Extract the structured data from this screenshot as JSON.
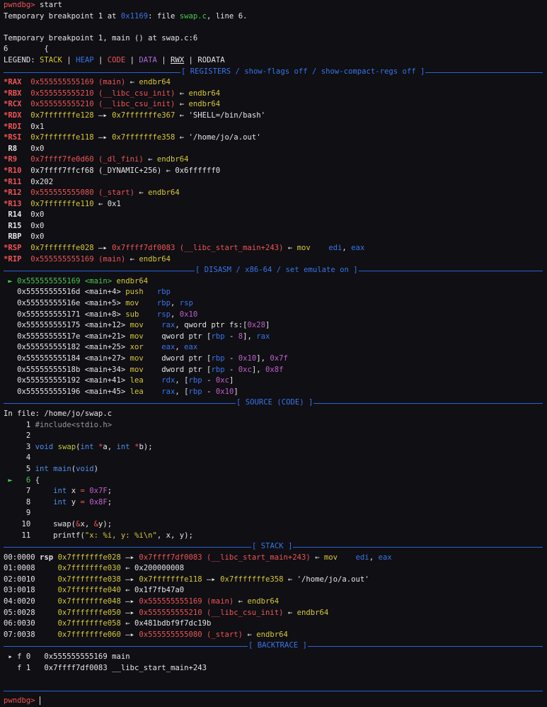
{
  "colors": {
    "bg": "#0f0f14",
    "red": "#ef5454",
    "blue": "#3a74e8",
    "green": "#4ac94a",
    "purple": "#b06bd6",
    "yellow": "#d8c73a"
  },
  "header": {
    "prompt": "pwndbg>",
    "command": " start",
    "bp_line_a": "Temporary breakpoint 1 at ",
    "bp_addr": "0x1169",
    "bp_line_b": ": file ",
    "bp_file": "swap.c",
    "bp_line_c": ", line 6.",
    "bp2": "Temporary breakpoint 1, main () at swap.c:6",
    "src_line": "6        {",
    "legend_label": "LEGEND: ",
    "legend_stack": "STACK",
    "legend_heap": "HEAP",
    "legend_code": "CODE",
    "legend_data": "DATA",
    "legend_rwx": "RWX",
    "legend_rodata": "RODATA",
    "pipe": " | "
  },
  "sections": {
    "registers": "[ REGISTERS / show-flags off / show-compact-regs off ]",
    "disasm": "[ DISASM / x86-64 / set emulate on ]",
    "source": "[ SOURCE (CODE) ]",
    "stack": "[ STACK ]",
    "backtrace": "[ BACKTRACE ]"
  },
  "registers": [
    {
      "mark": "*",
      "name": "RAX",
      "v1": "0x555555555169",
      "v1c": "red",
      "sym": " (main)",
      "symc": "red",
      "arrow": " ← ",
      "v2": "endbr64",
      "v2c": "yellow",
      "arrow2": "",
      "v3": "",
      "v3c": ""
    },
    {
      "mark": "*",
      "name": "RBX",
      "v1": "0x555555555210",
      "v1c": "red",
      "sym": " (__libc_csu_init)",
      "symc": "red",
      "arrow": " ← ",
      "v2": "endbr64",
      "v2c": "yellow",
      "arrow2": "",
      "v3": "",
      "v3c": ""
    },
    {
      "mark": "*",
      "name": "RCX",
      "v1": "0x555555555210",
      "v1c": "red",
      "sym": " (__libc_csu_init)",
      "symc": "red",
      "arrow": " ← ",
      "v2": "endbr64",
      "v2c": "yellow",
      "arrow2": "",
      "v3": "",
      "v3c": ""
    },
    {
      "mark": "*",
      "name": "RDX",
      "v1": "0x7fffffffe128",
      "v1c": "yellow",
      "sym": "",
      "symc": "",
      "arrow": " —▸ ",
      "v2": "0x7fffffffe367",
      "v2c": "yellow",
      "arrow2": " ← ",
      "v3": "'SHELL=/bin/bash'",
      "v3c": "white"
    },
    {
      "mark": "*",
      "name": "RDI",
      "v1": "0x1",
      "v1c": "white",
      "sym": "",
      "symc": "",
      "arrow": "",
      "v2": "",
      "v2c": "",
      "arrow2": "",
      "v3": "",
      "v3c": ""
    },
    {
      "mark": "*",
      "name": "RSI",
      "v1": "0x7fffffffe118",
      "v1c": "yellow",
      "sym": "",
      "symc": "",
      "arrow": " —▸ ",
      "v2": "0x7fffffffe358",
      "v2c": "yellow",
      "arrow2": " ← ",
      "v3": "'/home/jo/a.out'",
      "v3c": "white"
    },
    {
      "mark": " ",
      "name": "R8",
      "v1": "0x0",
      "v1c": "white",
      "sym": "",
      "symc": "",
      "arrow": "",
      "v2": "",
      "v2c": "",
      "arrow2": "",
      "v3": "",
      "v3c": ""
    },
    {
      "mark": "*",
      "name": "R9",
      "v1": "0x7ffff7fe0d60",
      "v1c": "red",
      "sym": " (_dl_fini)",
      "symc": "red",
      "arrow": " ← ",
      "v2": "endbr64",
      "v2c": "yellow",
      "arrow2": "",
      "v3": "",
      "v3c": ""
    },
    {
      "mark": "*",
      "name": "R10",
      "v1": "0x7ffff7ffcf68",
      "v1c": "white",
      "sym": " (_DYNAMIC+256)",
      "symc": "white",
      "arrow": " ← ",
      "v2": "0x6ffffff0",
      "v2c": "white",
      "arrow2": "",
      "v3": "",
      "v3c": ""
    },
    {
      "mark": "*",
      "name": "R11",
      "v1": "0x202",
      "v1c": "white",
      "sym": "",
      "symc": "",
      "arrow": "",
      "v2": "",
      "v2c": "",
      "arrow2": "",
      "v3": "",
      "v3c": ""
    },
    {
      "mark": "*",
      "name": "R12",
      "v1": "0x555555555080",
      "v1c": "red",
      "sym": " (_start)",
      "symc": "red",
      "arrow": " ← ",
      "v2": "endbr64",
      "v2c": "yellow",
      "arrow2": "",
      "v3": "",
      "v3c": ""
    },
    {
      "mark": "*",
      "name": "R13",
      "v1": "0x7fffffffe110",
      "v1c": "yellow",
      "sym": "",
      "symc": "",
      "arrow": " ← ",
      "v2": "0x1",
      "v2c": "white",
      "arrow2": "",
      "v3": "",
      "v3c": ""
    },
    {
      "mark": " ",
      "name": "R14",
      "v1": "0x0",
      "v1c": "white",
      "sym": "",
      "symc": "",
      "arrow": "",
      "v2": "",
      "v2c": "",
      "arrow2": "",
      "v3": "",
      "v3c": ""
    },
    {
      "mark": " ",
      "name": "R15",
      "v1": "0x0",
      "v1c": "white",
      "sym": "",
      "symc": "",
      "arrow": "",
      "v2": "",
      "v2c": "",
      "arrow2": "",
      "v3": "",
      "v3c": ""
    },
    {
      "mark": " ",
      "name": "RBP",
      "v1": "0x0",
      "v1c": "white",
      "sym": "",
      "symc": "",
      "arrow": "",
      "v2": "",
      "v2c": "",
      "arrow2": "",
      "v3": "",
      "v3c": ""
    },
    {
      "mark": "*",
      "name": "RSP",
      "v1": "0x7fffffffe028",
      "v1c": "yellow",
      "sym": "",
      "symc": "",
      "arrow": " —▸ ",
      "v2": "0x7ffff7df0083 (__libc_start_main+243)",
      "v2c": "red",
      "arrow2": " ← ",
      "v3": "mov    edi, eax",
      "v3c": "asm"
    },
    {
      "mark": "*",
      "name": "RIP",
      "v1": "0x555555555169",
      "v1c": "red",
      "sym": " (main)",
      "symc": "red",
      "arrow": " ← ",
      "v2": "endbr64",
      "v2c": "yellow",
      "arrow2": "",
      "v3": "",
      "v3c": ""
    }
  ],
  "disasm": [
    {
      "cur": true,
      "addr": "0x555555555169",
      "sym": "<main>",
      "op": "endbr64",
      "args": ""
    },
    {
      "cur": false,
      "addr": "0x55555555516d",
      "sym": "<main+4>",
      "op": "push",
      "args": "rbp"
    },
    {
      "cur": false,
      "addr": "0x55555555516e",
      "sym": "<main+5>",
      "op": "mov",
      "args": "rbp, rsp"
    },
    {
      "cur": false,
      "addr": "0x555555555171",
      "sym": "<main+8>",
      "op": "sub",
      "args": "rsp, 0x10"
    },
    {
      "cur": false,
      "addr": "0x555555555175",
      "sym": "<main+12>",
      "op": "mov",
      "args": "rax, qword ptr fs:[0x28]"
    },
    {
      "cur": false,
      "addr": "0x55555555517e",
      "sym": "<main+21>",
      "op": "mov",
      "args": "qword ptr [rbp - 8], rax"
    },
    {
      "cur": false,
      "addr": "0x555555555182",
      "sym": "<main+25>",
      "op": "xor",
      "args": "eax, eax"
    },
    {
      "cur": false,
      "addr": "0x555555555184",
      "sym": "<main+27>",
      "op": "mov",
      "args": "dword ptr [rbp - 0x10], 0x7f"
    },
    {
      "cur": false,
      "addr": "0x55555555518b",
      "sym": "<main+34>",
      "op": "mov",
      "args": "dword ptr [rbp - 0xc], 0x8f"
    },
    {
      "cur": false,
      "addr": "0x555555555192",
      "sym": "<main+41>",
      "op": "lea",
      "args": "rdx, [rbp - 0xc]"
    },
    {
      "cur": false,
      "addr": "0x555555555196",
      "sym": "<main+45>",
      "op": "lea",
      "args": "rax, [rbp - 0x10]"
    }
  ],
  "source": {
    "file_line": "In file: /home/jo/swap.c",
    "lines": [
      {
        "no": "1",
        "cur": false,
        "html": "<span class='c-gray'>#include&lt;stdio.h&gt;</span>"
      },
      {
        "no": "2",
        "cur": false,
        "html": ""
      },
      {
        "no": "3",
        "cur": false,
        "html": "<span class='c-kw'>void</span> <span class='c-fn'>swap</span>(<span class='c-kw'>int</span> <span class='c-red'>*</span>a, <span class='c-kw'>int</span> <span class='c-red'>*</span>b);"
      },
      {
        "no": "4",
        "cur": false,
        "html": ""
      },
      {
        "no": "5",
        "cur": false,
        "html": "<span class='c-kw'>int</span> <span class='c-kw'>main</span>(<span class='c-kw'>void</span>)"
      },
      {
        "no": "6",
        "cur": true,
        "html": "{"
      },
      {
        "no": "7",
        "cur": false,
        "html": "    <span class='c-kw'>int</span> x <span class='c-red'>=</span> <span class='c-num'>0x7F</span>;"
      },
      {
        "no": "8",
        "cur": false,
        "html": "    <span class='c-kw'>int</span> y <span class='c-red'>=</span> <span class='c-num'>0x8F</span>;"
      },
      {
        "no": "9",
        "cur": false,
        "html": ""
      },
      {
        "no": "10",
        "cur": false,
        "html": "    swap(<span class='c-red'>&amp;</span>x, <span class='c-red'>&amp;</span>y);"
      },
      {
        "no": "11",
        "cur": false,
        "html": "    printf(<span class='c-yellow'>\"x: %i, y: %i\\n\"</span>, x, y);"
      }
    ]
  },
  "stack": [
    {
      "off": "00:0000",
      "reg": "rsp",
      "addr": "0x7fffffffe028",
      "html": " —▸ <span class='c-red'>0x7ffff7df0083 (__libc_start_main+243)</span> ← <span class='c-yellow'>mov</span>    <span class='c-blue'>edi</span>, <span class='c-blue'>eax</span>"
    },
    {
      "off": "01:0008",
      "reg": "",
      "addr": "0x7fffffffe030",
      "html": " ← 0x200000008"
    },
    {
      "off": "02:0010",
      "reg": "",
      "addr": "0x7fffffffe038",
      "html": " —▸ <span class='c-yellow'>0x7fffffffe118</span> —▸ <span class='c-yellow'>0x7fffffffe358</span> ← '/home/jo/a.out'"
    },
    {
      "off": "03:0018",
      "reg": "",
      "addr": "0x7fffffffe040",
      "html": " ← 0x1f7fb47a0"
    },
    {
      "off": "04:0020",
      "reg": "",
      "addr": "0x7fffffffe048",
      "html": " —▸ <span class='c-red'>0x555555555169 (main)</span> ← <span class='c-yellow'>endbr64</span>"
    },
    {
      "off": "05:0028",
      "reg": "",
      "addr": "0x7fffffffe050",
      "html": " —▸ <span class='c-red'>0x555555555210 (__libc_csu_init)</span> ← <span class='c-yellow'>endbr64</span>"
    },
    {
      "off": "06:0030",
      "reg": "",
      "addr": "0x7fffffffe058",
      "html": " ← 0x481bdbf9f7dc19b"
    },
    {
      "off": "07:0038",
      "reg": "",
      "addr": "0x7fffffffe060",
      "html": " —▸ <span class='c-red'>0x555555555080 (_start)</span> ← <span class='c-yellow'>endbr64</span>"
    }
  ],
  "backtrace": [
    {
      "cur": true,
      "frame": "f 0",
      "addr": "0x555555555169",
      "name": "main"
    },
    {
      "cur": false,
      "frame": "f 1",
      "addr": "0x7ffff7df0083",
      "name": "__libc_start_main+243"
    }
  ],
  "footer": {
    "prompt": "pwndbg>"
  }
}
